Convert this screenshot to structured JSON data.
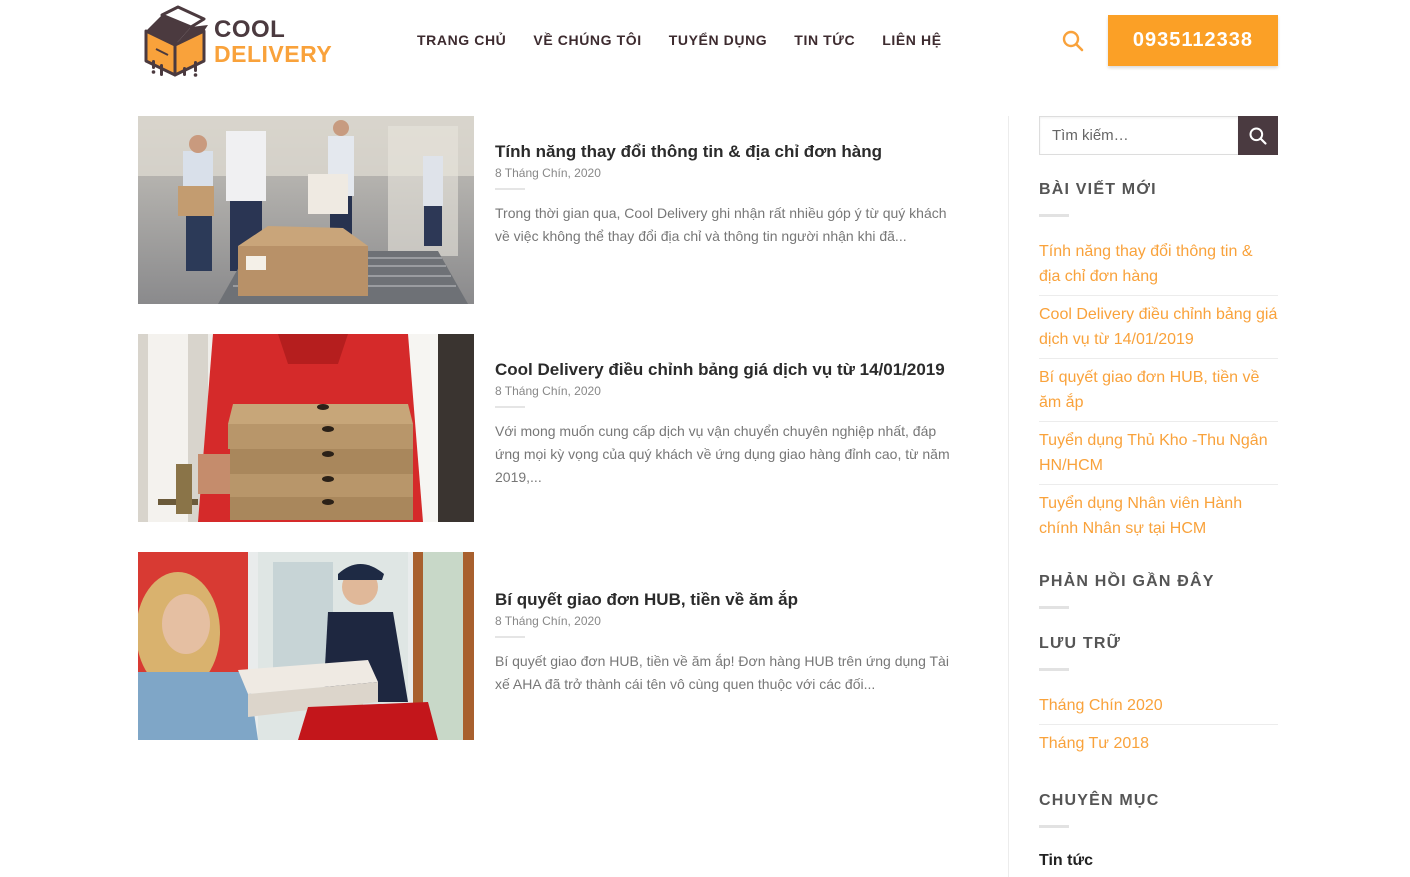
{
  "brand": {
    "line1": "COOL",
    "line2": "DELIVERY",
    "colors": {
      "dark": "#4b3a3f",
      "accent": "#f9a23b"
    }
  },
  "nav": {
    "items": [
      {
        "label": "TRANG CHỦ"
      },
      {
        "label": "VỀ CHÚNG TÔI"
      },
      {
        "label": "TUYỂN DỤNG"
      },
      {
        "label": "TIN TỨC"
      },
      {
        "label": "LIÊN HỆ"
      }
    ],
    "search_icon": "search-icon",
    "phone": "0935112338"
  },
  "posts": [
    {
      "title": "Tính năng thay đổi thông tin & địa chỉ đơn hàng",
      "date": "8 Tháng Chín, 2020",
      "excerpt": "Trong thời gian qua, Cool Delivery ghi nhận rất nhiều góp ý từ quý khách về việc không thể thay đổi địa chỉ và thông tin người nhận khi đã..."
    },
    {
      "title": "Cool Delivery điều chỉnh bảng giá dịch vụ từ 14/01/2019",
      "date": "8 Tháng Chín, 2020",
      "excerpt": "Với mong muốn cung cấp dịch vụ vận chuyển chuyên nghiệp nhất, đáp ứng mọi kỳ vọng của quý khách về ứng dụng giao hàng đỉnh cao, từ năm 2019,..."
    },
    {
      "title": "Bí quyết giao đơn HUB, tiền về ăm ắp",
      "date": "8 Tháng Chín, 2020",
      "excerpt": "Bí quyết giao đơn HUB, tiền về ăm ắp! Đơn hàng HUB trên ứng dụng Tài xế AHA đã trở thành cái tên vô cùng quen thuộc với các đối..."
    }
  ],
  "sidebar": {
    "search_placeholder": "Tìm kiếm…",
    "recent_title": "BÀI VIẾT MỚI",
    "recent_posts": [
      "Tính năng thay đổi thông tin & địa chỉ đơn hàng",
      "Cool Delivery điều chỉnh bảng giá dịch vụ từ 14/01/2019",
      "Bí quyết giao đơn HUB, tiền về ăm ắp",
      "Tuyển dụng Thủ Kho -Thu Ngân HN/HCM",
      "Tuyển dụng Nhân viên Hành chính Nhân sự tại HCM"
    ],
    "comments_title": "PHẢN HỒI GẦN ĐÂY",
    "archive_title": "LƯU TRỮ",
    "archives": [
      "Tháng Chín 2020",
      "Tháng Tư 2018"
    ],
    "categories_title": "CHUYÊN MỤC",
    "categories": [
      "Tin tức"
    ]
  }
}
